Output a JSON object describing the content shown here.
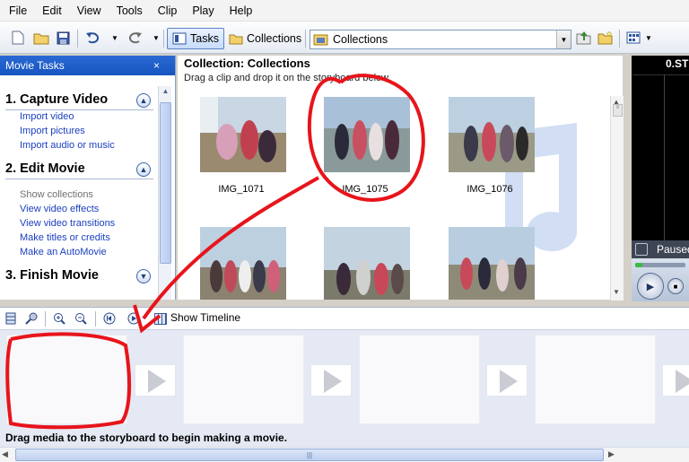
{
  "menu": [
    "File",
    "Edit",
    "View",
    "Tools",
    "Clip",
    "Play",
    "Help"
  ],
  "toolbar": {
    "tasks_label": "Tasks",
    "collections_label": "Collections",
    "collection_select": "Collections"
  },
  "task_pane": {
    "title": "Movie Tasks",
    "close": "×",
    "sections": [
      {
        "title": "1. Capture Video",
        "items": [
          "Import video",
          "Import pictures",
          "Import audio or music"
        ]
      },
      {
        "title": "2. Edit Movie",
        "items": [
          "Show collections",
          "View video effects",
          "View video transitions",
          "Make titles or credits",
          "Make an AutoMovie"
        ]
      },
      {
        "title": "3. Finish Movie",
        "items": []
      }
    ]
  },
  "collection": {
    "title": "Collection: Collections",
    "subtitle": "Drag a clip and drop it on the storyboard below.",
    "clips": [
      {
        "name": "IMG_1071"
      },
      {
        "name": "IMG_1075"
      },
      {
        "name": "IMG_1076"
      },
      {
        "name": ""
      },
      {
        "name": ""
      },
      {
        "name": ""
      }
    ]
  },
  "monitor": {
    "time": "0.ST",
    "status": "Paused",
    "progress": 0.15
  },
  "storyboard": {
    "show_timeline": "Show Timeline",
    "status": "Drag media to the storyboard to begin making a movie.",
    "scroll_grip": "|||"
  },
  "colors": {
    "annotation": "#e8141b",
    "task_header": "#1654c0",
    "link": "#1a3fbf"
  },
  "icons": [
    "new-project-icon",
    "open-project-icon",
    "save-icon",
    "undo-icon",
    "redo-icon",
    "tasks-icon",
    "folder-icon",
    "collection-icon",
    "up-folder-icon",
    "new-folder-icon",
    "view-icon"
  ]
}
